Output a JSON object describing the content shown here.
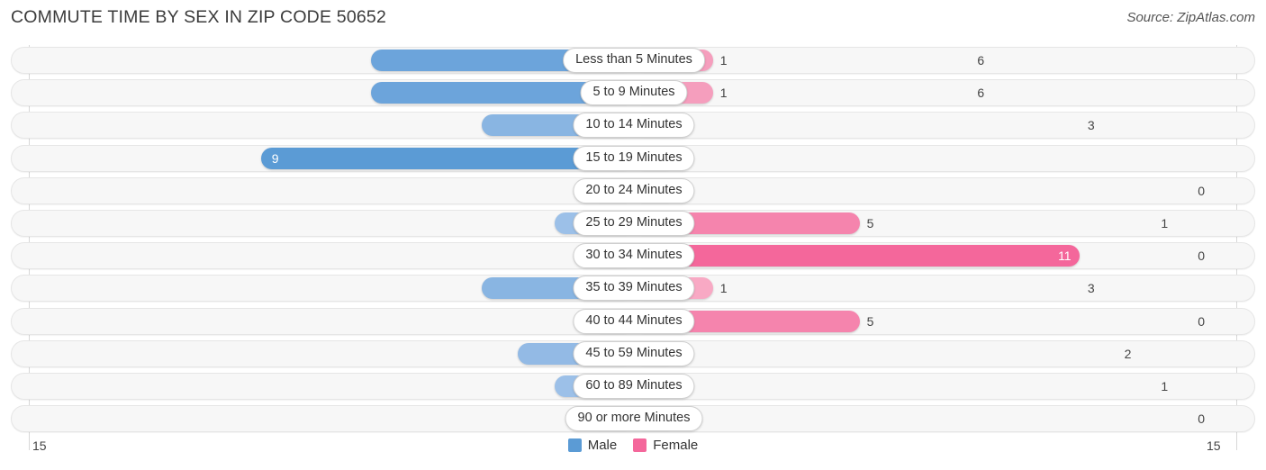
{
  "header": {
    "title": "COMMUTE TIME BY SEX IN ZIP CODE 50652",
    "source": "Source: ZipAtlas.com"
  },
  "legend": {
    "male_label": "Male",
    "female_label": "Female",
    "male_color": "#5b9bd5",
    "female_color": "#f4679b"
  },
  "axis": {
    "left_max_label": "15",
    "right_max_label": "15",
    "max": 15
  },
  "chart_data": {
    "type": "bar",
    "orientation": "horizontal-diverging",
    "title": "COMMUTE TIME BY SEX IN ZIP CODE 50652",
    "xlabel": "",
    "ylabel": "",
    "xlim": [
      15,
      15
    ],
    "grid": true,
    "legend_position": "bottom-center",
    "categories": [
      "Less than 5 Minutes",
      "5 to 9 Minutes",
      "10 to 14 Minutes",
      "15 to 19 Minutes",
      "20 to 24 Minutes",
      "25 to 29 Minutes",
      "30 to 34 Minutes",
      "35 to 39 Minutes",
      "40 to 44 Minutes",
      "45 to 59 Minutes",
      "60 to 89 Minutes",
      "90 or more Minutes"
    ],
    "series": [
      {
        "name": "Male",
        "values": [
          6,
          6,
          3,
          9,
          0,
          1,
          0,
          3,
          0,
          2,
          1,
          0
        ]
      },
      {
        "name": "Female",
        "values": [
          1,
          1,
          0,
          0,
          0,
          5,
          11,
          1,
          5,
          0,
          0,
          0
        ]
      }
    ]
  },
  "rows": [
    {
      "label": "Less than 5 Minutes",
      "male": "6",
      "female": "1",
      "male_val": 6,
      "female_val": 1,
      "male_color": "#6ca4db",
      "female_color": "#f59ebd",
      "male_inside": false,
      "female_inside": false
    },
    {
      "label": "5 to 9 Minutes",
      "male": "6",
      "female": "1",
      "male_val": 6,
      "female_val": 1,
      "male_color": "#6ca4db",
      "female_color": "#f59ebd",
      "male_inside": false,
      "female_inside": false
    },
    {
      "label": "10 to 14 Minutes",
      "male": "3",
      "female": "0",
      "male_val": 3,
      "female_val": 0,
      "male_color": "#89b5e2",
      "female_color": "#f8a9c4",
      "male_inside": false,
      "female_inside": false
    },
    {
      "label": "15 to 19 Minutes",
      "male": "9",
      "female": "0",
      "male_val": 9,
      "female_val": 0,
      "male_color": "#5b9bd5",
      "female_color": "#f8a9c4",
      "male_inside": true,
      "female_inside": false
    },
    {
      "label": "20 to 24 Minutes",
      "male": "0",
      "female": "0",
      "male_val": 0,
      "female_val": 0,
      "male_color": "#a8c8ec",
      "female_color": "#f8a9c4",
      "male_inside": false,
      "female_inside": false
    },
    {
      "label": "25 to 29 Minutes",
      "male": "1",
      "female": "5",
      "male_val": 1,
      "female_val": 5,
      "male_color": "#9cc0e8",
      "female_color": "#f584ad",
      "male_inside": false,
      "female_inside": false
    },
    {
      "label": "30 to 34 Minutes",
      "male": "0",
      "female": "11",
      "male_val": 0,
      "female_val": 11,
      "male_color": "#a8c8ec",
      "female_color": "#f4679b",
      "male_inside": false,
      "female_inside": true
    },
    {
      "label": "35 to 39 Minutes",
      "male": "3",
      "female": "1",
      "male_val": 3,
      "female_val": 1,
      "male_color": "#89b5e2",
      "female_color": "#f8a9c4",
      "male_inside": false,
      "female_inside": false
    },
    {
      "label": "40 to 44 Minutes",
      "male": "0",
      "female": "5",
      "male_val": 0,
      "female_val": 5,
      "male_color": "#a8c8ec",
      "female_color": "#f584ad",
      "male_inside": false,
      "female_inside": false
    },
    {
      "label": "45 to 59 Minutes",
      "male": "2",
      "female": "0",
      "male_val": 2,
      "female_val": 0,
      "male_color": "#93bae5",
      "female_color": "#f8a9c4",
      "male_inside": false,
      "female_inside": false
    },
    {
      "label": "60 to 89 Minutes",
      "male": "1",
      "female": "0",
      "male_val": 1,
      "female_val": 0,
      "male_color": "#9cc0e8",
      "female_color": "#f8a9c4",
      "male_inside": false,
      "female_inside": false
    },
    {
      "label": "90 or more Minutes",
      "male": "0",
      "female": "0",
      "male_val": 0,
      "female_val": 0,
      "male_color": "#a8c8ec",
      "female_color": "#f8a9c4",
      "male_inside": false,
      "female_inside": false
    }
  ]
}
